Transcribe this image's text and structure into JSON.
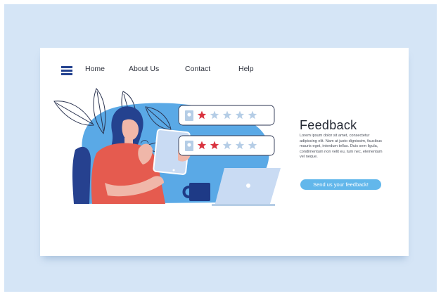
{
  "nav": {
    "links": [
      "Home",
      "About Us",
      "Contact",
      "Help"
    ]
  },
  "hero": {
    "title": "Feedback",
    "body": "Lorem ipsum dolor sit amet, consectetur adipiscing elit. Nam at justo dignissim, faucibus mauris eget, interdum tellus. Duis sem ligula, condimentum non velit eu, tum nec, elementum vel neque.",
    "cta_label": "Send us your feedback!"
  },
  "rating_cards": [
    {
      "rating": 1,
      "max": 5
    },
    {
      "rating": 2,
      "max": 5
    }
  ],
  "colors": {
    "backdrop": "#d5e5f6",
    "accent": "#62b7eb",
    "star_filled": "#d9333f",
    "star_empty": "#b5cde6",
    "navy": "#24428f",
    "blob": "#5aa9e6"
  },
  "icons": [
    "hamburger-menu-icon",
    "user-avatar-icon",
    "star-icon",
    "laptop-icon",
    "tablet-icon",
    "mug-icon"
  ]
}
